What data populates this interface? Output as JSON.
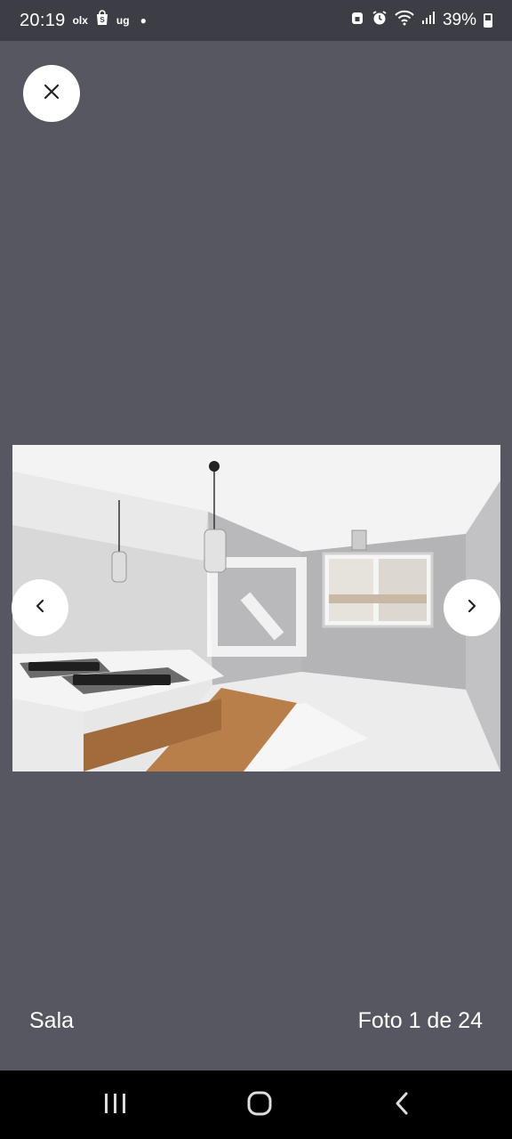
{
  "status_bar": {
    "time": "20:19",
    "app_notifications": [
      "olx",
      "ug"
    ],
    "battery_percent": "39%",
    "icons": [
      "olx-icon",
      "shopping-bag-icon",
      "ug-icon",
      "notification-dot",
      "lock-badge-icon",
      "alarm-icon",
      "wifi-icon",
      "signal-icon",
      "battery-icon"
    ]
  },
  "viewer": {
    "close_icon": "close-icon",
    "prev_icon": "chevron-left-icon",
    "next_icon": "chevron-right-icon",
    "photo_alt": "Sala"
  },
  "caption": {
    "label": "Sala",
    "counter": "Foto 1 de 24"
  },
  "system_nav": {
    "icons": [
      "recents-icon",
      "home-icon",
      "back-icon"
    ]
  },
  "colors": {
    "background": "#565760",
    "status_bar": "#3d3e45",
    "button": "#ffffff",
    "text": "#ffffff"
  }
}
